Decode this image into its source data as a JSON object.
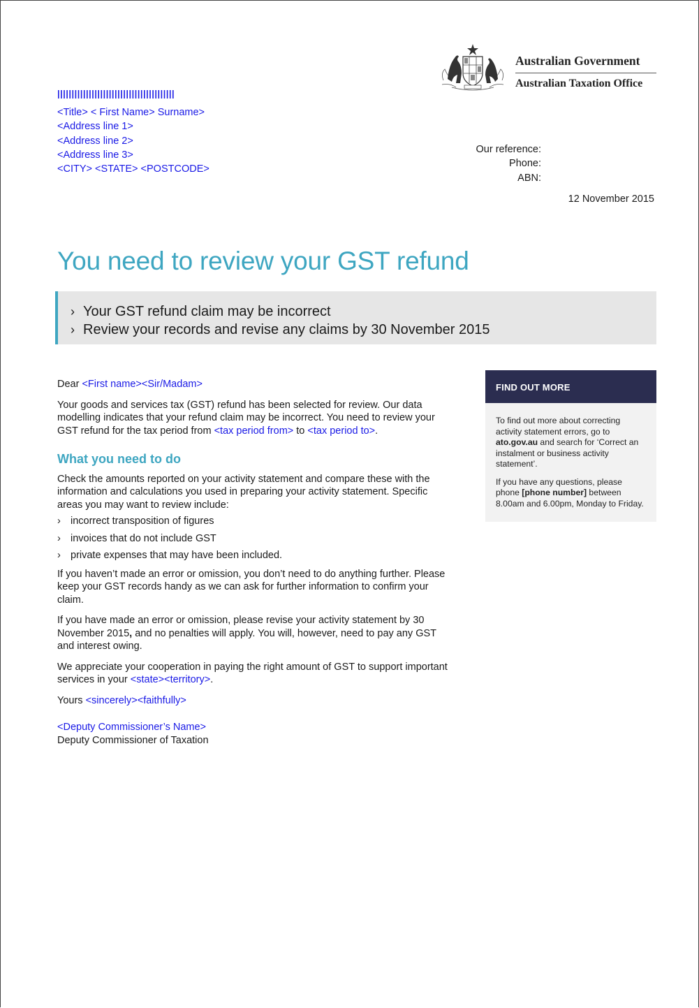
{
  "header": {
    "gov_name": "Australian Government",
    "agency_name": "Australian Taxation Office"
  },
  "recipient": {
    "name_line": "<Title> < First Name> Surname>",
    "address_1": "<Address line 1>",
    "address_2": "<Address line 2>",
    "address_3": "<Address line 3>",
    "city_line": "<CITY> <STATE> <POSTCODE>"
  },
  "references": {
    "our_reference": "Our reference:",
    "phone": "Phone:",
    "abn": "ABN:"
  },
  "date": "12 November 2015",
  "title": "You need to review your GST refund",
  "summary": [
    "Your GST refund claim may be incorrect",
    "Review your records and revise any claims by 30 November 2015"
  ],
  "letter": {
    "salutation_prefix": "Dear ",
    "salutation_name": "<First name><Sir/Madam>",
    "para1_text": "Your goods and services tax (GST) refund has been selected for review. Our data modelling indicates that your refund claim may be incorrect. You need to review your GST refund for the tax period from ",
    "para1_from": "<tax period from>",
    "para1_mid": " to ",
    "para1_to": "<tax period to>",
    "para1_end": ".",
    "heading": "What you need to do",
    "para2": "Check the amounts reported on your activity statement and compare these with the information and calculations you used in preparing your activity statement. Specific areas you may want to review include:",
    "bullets": [
      "incorrect transposition of figures",
      "invoices that do not include GST",
      "private expenses that may have been included."
    ],
    "para3": "If you haven’t made an error or omission, you don’t need to do anything further. Please keep your GST records handy as we can ask for further information to confirm your claim.",
    "para4_start": "If you have made an error or omission, please revise your activity statement by 30 November 2015",
    "para4_comma": ",",
    "para4_end": " and no penalties will apply. You will, however, need to pay any GST and interest owing.",
    "para5_text": "We appreciate your cooperation in paying the right amount of GST to support important services in your ",
    "para5_placeholder": "<state><territory>",
    "para5_end": ".",
    "closing_prefix": "Yours ",
    "closing_placeholder": "<sincerely><faithfully>",
    "signatory_name": "<Deputy Commissioner’s Name>",
    "signatory_title": "Deputy Commissioner of Taxation"
  },
  "sidebar": {
    "heading": "FIND OUT MORE",
    "p1_start": "To find out more about correcting activity statement errors, go to ",
    "p1_link": "ato.gov.au",
    "p1_end": " and search for ‘Correct an instalment or business activity statement’.",
    "p2_start": "If you have any questions, please phone ",
    "p2_bold": "[phone number]",
    "p2_end": " between 8.00am and 6.00pm, Monday to Friday."
  },
  "bullet_glyph": "›",
  "colors": {
    "accent": "#3ea6c1",
    "placeholder": "#1a1ae6",
    "sidebar_header": "#2b2d50",
    "summary_bg": "#e6e6e6"
  }
}
